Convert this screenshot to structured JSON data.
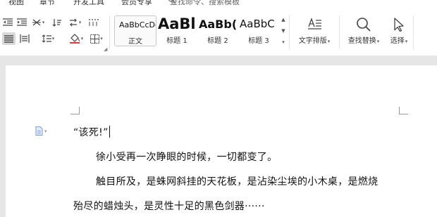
{
  "menu": {
    "items": [
      "视图",
      "章节",
      "开发工具",
      "会员专享"
    ],
    "search_placeholder": "查找命令、搜索模板"
  },
  "styles": {
    "items": [
      {
        "sample": "AaBbCcDc",
        "label": "正文"
      },
      {
        "sample": "AaBl",
        "label": "标题 1"
      },
      {
        "sample": "AaBb(",
        "label": "标题 2"
      },
      {
        "sample": "AaBbC",
        "label": "标题 3"
      }
    ]
  },
  "tools": {
    "text_layout": "文字排版",
    "find_replace": "查找替换",
    "select": "选择"
  },
  "document": {
    "lines": [
      "“该死!”",
      "徐小受再一次睁眼的时候，一切都变了。",
      "触目所及，是蛛网斜挂的天花板，是沾染尘埃的小木桌，是燃烧",
      "殆尽的蜡烛头，是灵性十足的黑色剑器······"
    ]
  },
  "colors": {
    "ribbon_bg": "#ffffff",
    "canvas_bg": "#e6e6e6",
    "page_bg": "#ffffff",
    "text": "#111111"
  }
}
